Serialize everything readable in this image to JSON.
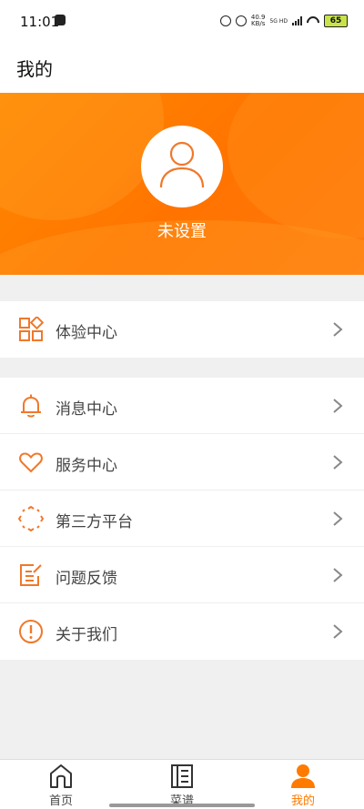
{
  "status_bar": {
    "time": "11:01",
    "net_speed_value": "40.9",
    "net_speed_unit": "KB/s",
    "net_type": "5G HD",
    "battery": "65"
  },
  "header": {
    "title": "我的"
  },
  "profile": {
    "username": "未设置"
  },
  "menu": {
    "group1": [
      {
        "label": "体验中心",
        "icon": "apps-grid-icon"
      }
    ],
    "group2": [
      {
        "label": "消息中心",
        "icon": "bell-icon"
      },
      {
        "label": "服务中心",
        "icon": "heart-icon"
      },
      {
        "label": "第三方平台",
        "icon": "platform-icon"
      },
      {
        "label": "问题反馈",
        "icon": "feedback-icon"
      },
      {
        "label": "关于我们",
        "icon": "info-icon"
      }
    ]
  },
  "tabs": [
    {
      "label": "首页",
      "icon": "home-icon",
      "active": false
    },
    {
      "label": "菜谱",
      "icon": "recipe-book-icon",
      "active": false
    },
    {
      "label": "我的",
      "icon": "person-icon",
      "active": true
    }
  ],
  "colors": {
    "accent": "#ff7a00",
    "icon_stroke": "#f0782a"
  }
}
